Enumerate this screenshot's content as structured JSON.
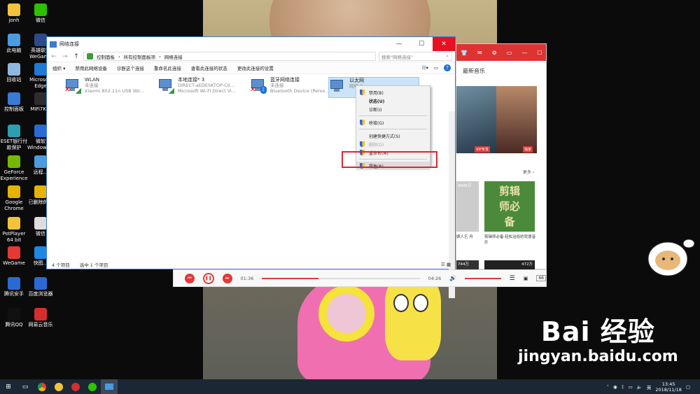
{
  "desktop": {
    "icons": [
      {
        "label": "jonh",
        "color": "#f2c33b"
      },
      {
        "label": "微信",
        "color": "#2dc100"
      },
      {
        "label": "此电脑",
        "color": "#4a9be0"
      },
      {
        "label": "英雄联盟WeGame",
        "color": "#2a4a8a"
      },
      {
        "label": "回收站",
        "color": "#8fb8e0"
      },
      {
        "label": "Microsoft Edge",
        "color": "#1e7ad6"
      },
      {
        "label": "控制面板",
        "color": "#3a7bd5"
      },
      {
        "label": "MIFi7K...",
        "color": "#2d2d2d"
      },
      {
        "label": "ESET银行付款保护",
        "color": "#2c9fb0"
      },
      {
        "label": "微软Windows...",
        "color": "#2a6ad6"
      },
      {
        "label": "GeForce Experience",
        "color": "#76b900"
      },
      {
        "label": "远程...",
        "color": "#4a9be0"
      },
      {
        "label": "Google Chrome",
        "color": "#e6b400"
      },
      {
        "label": "已删除的...",
        "color": "#e6b400"
      },
      {
        "label": "PotPlayer 64 bit",
        "color": "#f2c33b"
      },
      {
        "label": "微信",
        "color": "#dddddd"
      },
      {
        "label": "WeGame",
        "color": "#e53935"
      },
      {
        "label": "快图...",
        "color": "#1e88e5"
      },
      {
        "label": "腾讯安手",
        "color": "#2a6ad6"
      },
      {
        "label": "百度浏览器",
        "color": "#2a6ad6"
      },
      {
        "label": "腾讯QQ",
        "color": "#111111"
      },
      {
        "label": "网易云音乐",
        "color": "#d32f2f"
      }
    ]
  },
  "explorer": {
    "title": "网络连接",
    "minimize": "—",
    "maximize": "☐",
    "close": "✕",
    "back": "←",
    "forward": "→",
    "up": "↑",
    "breadcrumb": [
      "控制面板",
      "所有控制面板项",
      "网络连接"
    ],
    "search_placeholder": "搜索\"网络连接\"",
    "commands": [
      "组织 ▾",
      "禁用此网络设备",
      "诊断这个连接",
      "重命名此连接",
      "查看此连接的状态",
      "更改此连接的设置"
    ],
    "connections": [
      {
        "name": "WLAN",
        "status": "未连接",
        "device": "Xiaomi 802.11n USB Wir..."
      },
      {
        "name": "本地连接* 3",
        "status": "DIRECT-aEDESKTOP-C0...",
        "device": "Microsoft Wi-Fi Direct Vi..."
      },
      {
        "name": "蓝牙网络连接",
        "status": "未连接",
        "device": "Bluetooth Device (Perso..."
      },
      {
        "name": "以太网",
        "status": "网络 2",
        "device": ""
      }
    ],
    "status_count": "4 个项目",
    "status_selected": "选中 1 个项目"
  },
  "context_menu": {
    "items": [
      "禁用(B)",
      "状态(U)",
      "诊断(I)",
      "桥接(G)",
      "创建快捷方式(S)",
      "删除(D)",
      "重命名(M)",
      "属性(R)"
    ]
  },
  "music": {
    "section": "最新音乐",
    "more": "更多 ›",
    "tag_vip": "VIP专享",
    "tag_exclusive": "独家",
    "count1": "4945万",
    "count2": "744万",
    "count3": "472万",
    "banner_text": "剪辑师必备",
    "caption1": "嫁人乞 舟",
    "caption2": "剪辑师必备·轻松治愈的背景音乐",
    "time_current": "01:36",
    "time_total": "04:26",
    "volume_badge": "66"
  },
  "watermark": {
    "logo": "Bai 经验",
    "url": "jingyan.baidu.com"
  },
  "taskbar": {
    "time": "13:45",
    "date": "2018/11/18",
    "lang": "英"
  }
}
